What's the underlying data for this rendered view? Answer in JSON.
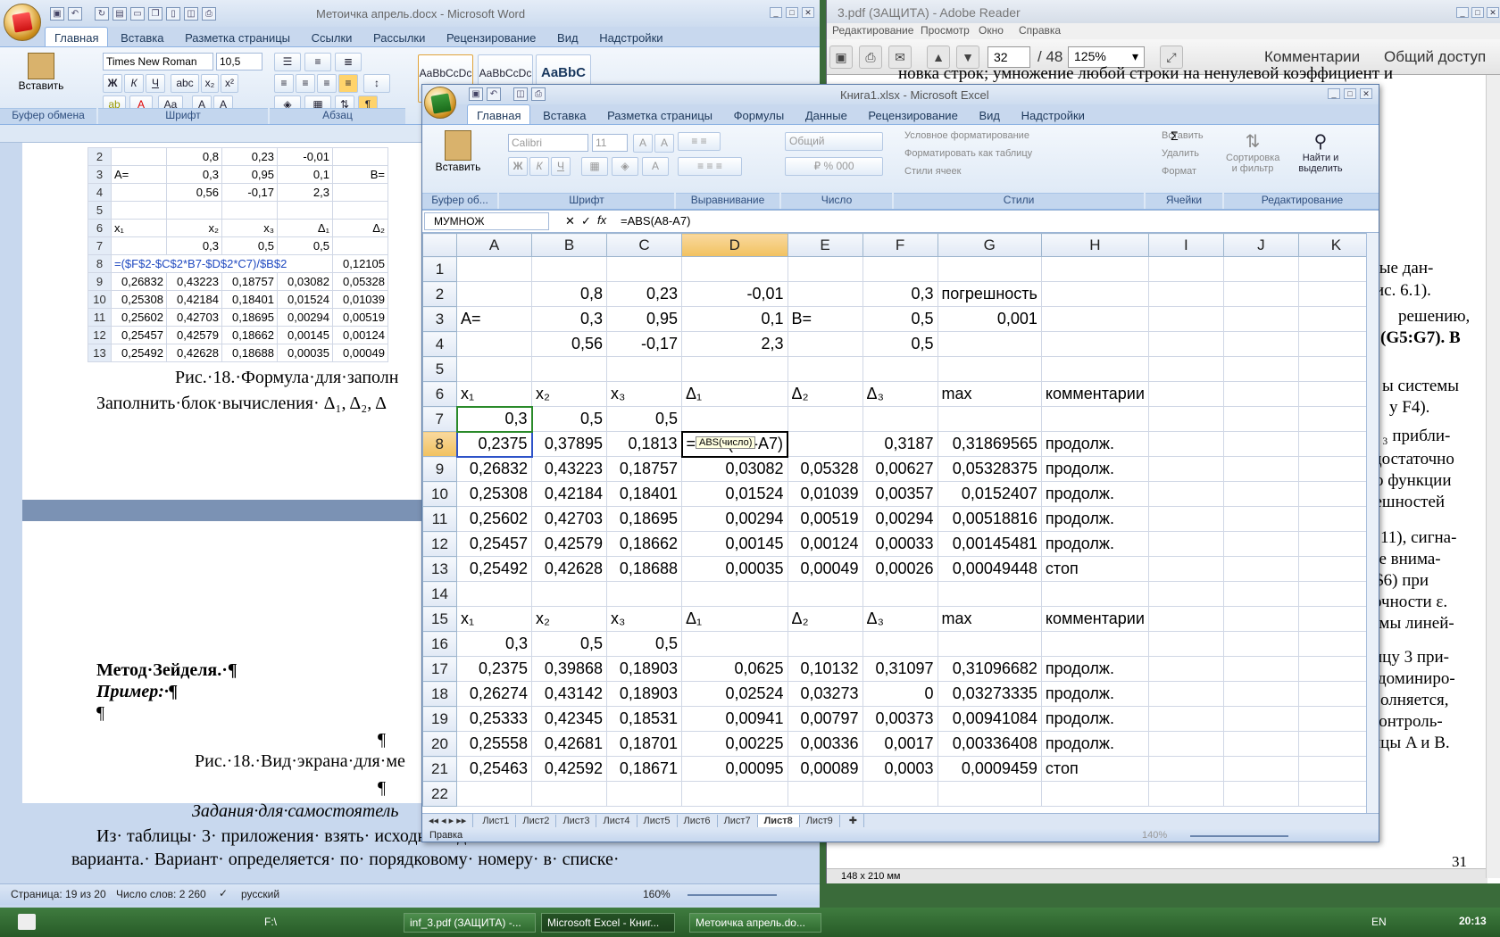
{
  "reader": {
    "title": "3.pdf (ЗАЩИТА) - Adobe Reader",
    "menu": [
      "Редактирование",
      "Просмотр",
      "Окно",
      "Справка"
    ],
    "page_current": "32",
    "page_total": "/ 48",
    "zoom": "125%",
    "comments": "Комментарии",
    "share": "Общий доступ",
    "page_lines": [
      "новка строк; умножение любой строки на ненулевой коэффициент и",
      "й",
      "одные дан-",
      ", рис. 6.1).",
      "решению,",
      "(G5:G7). В",
      "ы системы",
      "у F4).",
      "₃ прибли-",
      "достаточно",
      "о функции",
      "решностей",
      "11), сигна-",
      "ите внима-",
      "($I$6) при",
      "точности ε.",
      "емы линей-",
      "ицу 3 при-",
      "доминиро-",
      "олняется,",
      "контроль-",
      "ицы A и B."
    ],
    "page_number": "31",
    "page_size": "148 x 210 мм"
  },
  "word": {
    "title": "Метоичка апрель.docx - Microsoft Word",
    "tabs": [
      "Главная",
      "Вставка",
      "Разметка страницы",
      "Ссылки",
      "Рассылки",
      "Рецензирование",
      "Вид",
      "Надстройки"
    ],
    "font_name": "Times New Roman",
    "font_size": "10,5",
    "paste": "Вставить",
    "groups": [
      "Буфер обмена",
      "Шрифт",
      "Абзац"
    ],
    "style1": "AaBbCcDc",
    "style2": "AaBbCcDc",
    "style3": "AaBbC",
    "sheet_rows": [
      [
        "2",
        "",
        "0,8",
        "0,23",
        "-0,01",
        ""
      ],
      [
        "3",
        "A=",
        "0,3",
        "0,95",
        "0,1",
        "B="
      ],
      [
        "4",
        "",
        "0,56",
        "-0,17",
        "2,3",
        ""
      ],
      [
        "5",
        "",
        "",
        "",
        "",
        ""
      ],
      [
        "6",
        "x₁",
        "x₂",
        "x₃",
        "Δ₁",
        "Δ₂"
      ],
      [
        "7",
        "",
        "0,3",
        "0,5",
        "0,5",
        ""
      ],
      [
        "8",
        "=($F$2-$C$2*B7-$D$2*C7)/$B$2",
        "",
        "",
        "",
        "0,12105"
      ],
      [
        "9",
        "0,26832",
        "0,43223",
        "0,18757",
        "0,03082",
        "0,05328"
      ],
      [
        "10",
        "0,25308",
        "0,42184",
        "0,18401",
        "0,01524",
        "0,01039"
      ],
      [
        "11",
        "0,25602",
        "0,42703",
        "0,18695",
        "0,00294",
        "0,00519"
      ],
      [
        "12",
        "0,25457",
        "0,42579",
        "0,18662",
        "0,00145",
        "0,00124"
      ],
      [
        "13",
        "0,25492",
        "0,42628",
        "0,18688",
        "0,00035",
        "0,00049"
      ]
    ],
    "caption1": "Рис.·18.·Формула·для·заполн",
    "line2": "Заполнить·блок·вычисления· Δ₁, Δ₂, Δ",
    "seidel": "Метод·Зейделя.·¶",
    "example": "Пример:·¶",
    "pilcrow": "¶",
    "caption2": "Рис.·18.·Вид·экрана·для·ме",
    "tasks": "Задания·для·самостоятель",
    "line_a": "Из· таблицы· 3· приложения· взять· исходные· данные· своего",
    "line_b": "варианта.· Вариант· определяется· по· порядковому· номеру· в· списке·",
    "status_page": "Страница: 19 из 20",
    "status_words": "Число слов: 2 260",
    "status_lang": "русский",
    "zoom": "160%"
  },
  "excel": {
    "title": "Книга1.xlsx - Microsoft Excel",
    "tabs": [
      "Главная",
      "Вставка",
      "Разметка страницы",
      "Формулы",
      "Данные",
      "Рецензирование",
      "Вид",
      "Надстройки"
    ],
    "paste": "Вставить",
    "font_name": "Calibri",
    "font_size": "11",
    "number_format": "Общий",
    "styles": [
      "Условное форматирование",
      "Форматировать как таблицу",
      "Стили ячеек"
    ],
    "cells_btns": [
      "Вставить",
      "Удалить",
      "Формат"
    ],
    "edit_btns": [
      "Сортировка и фильтр",
      "Найти и выделить"
    ],
    "groups": [
      "Буфер об...",
      "Шрифт",
      "Выравнивание",
      "Число",
      "Стили",
      "Ячейки",
      "Редактирование"
    ],
    "name_box": "МУМНОЖ",
    "formula": "=ABS(A8-A7)",
    "tooltip": "ABS(число)",
    "columns": [
      "A",
      "B",
      "C",
      "D",
      "E",
      "F",
      "G",
      "H",
      "I",
      "J",
      "K"
    ],
    "rows": [
      [
        "1",
        "",
        "",
        "",
        "",
        "",
        "",
        "",
        "",
        "",
        "",
        ""
      ],
      [
        "2",
        "",
        "0,8",
        "0,23",
        "-0,01",
        "",
        "0,3",
        "погрешность",
        "",
        "",
        "",
        ""
      ],
      [
        "3",
        "A=",
        "0,3",
        "0,95",
        "0,1",
        "B=",
        "0,5",
        "0,001",
        "",
        "",
        "",
        ""
      ],
      [
        "4",
        "",
        "0,56",
        "-0,17",
        "2,3",
        "",
        "0,5",
        "",
        "",
        "",
        "",
        ""
      ],
      [
        "5",
        "",
        "",
        "",
        "",
        "",
        "",
        "",
        "",
        "",
        "",
        ""
      ],
      [
        "6",
        "x₁",
        "x₂",
        "x₃",
        "Δ₁",
        "Δ₂",
        "Δ₃",
        "max",
        "комментарии",
        "",
        "",
        ""
      ],
      [
        "7",
        "0,3",
        "0,5",
        "0,5",
        "",
        "",
        "",
        "",
        "",
        "",
        "",
        ""
      ],
      [
        "8",
        "0,2375",
        "0,37895",
        "0,1813",
        "=ABS(A8-A7)",
        "",
        "0,3187",
        "0,31869565",
        "продолж.",
        "",
        "",
        ""
      ],
      [
        "9",
        "0,26832",
        "0,43223",
        "0,18757",
        "0,03082",
        "0,05328",
        "0,00627",
        "0,05328375",
        "продолж.",
        "",
        "",
        ""
      ],
      [
        "10",
        "0,25308",
        "0,42184",
        "0,18401",
        "0,01524",
        "0,01039",
        "0,00357",
        "0,0152407",
        "продолж.",
        "",
        "",
        ""
      ],
      [
        "11",
        "0,25602",
        "0,42703",
        "0,18695",
        "0,00294",
        "0,00519",
        "0,00294",
        "0,00518816",
        "продолж.",
        "",
        "",
        ""
      ],
      [
        "12",
        "0,25457",
        "0,42579",
        "0,18662",
        "0,00145",
        "0,00124",
        "0,00033",
        "0,00145481",
        "продолж.",
        "",
        "",
        ""
      ],
      [
        "13",
        "0,25492",
        "0,42628",
        "0,18688",
        "0,00035",
        "0,00049",
        "0,00026",
        "0,00049448",
        "стоп",
        "",
        "",
        ""
      ],
      [
        "14",
        "",
        "",
        "",
        "",
        "",
        "",
        "",
        "",
        "",
        "",
        ""
      ],
      [
        "15",
        "x₁",
        "x₂",
        "x₃",
        "Δ₁",
        "Δ₂",
        "Δ₃",
        "max",
        "комментарии",
        "",
        "",
        ""
      ],
      [
        "16",
        "0,3",
        "0,5",
        "0,5",
        "",
        "",
        "",
        "",
        "",
        "",
        "",
        ""
      ],
      [
        "17",
        "0,2375",
        "0,39868",
        "0,18903",
        "0,0625",
        "0,10132",
        "0,31097",
        "0,31096682",
        "продолж.",
        "",
        "",
        ""
      ],
      [
        "18",
        "0,26274",
        "0,43142",
        "0,18903",
        "0,02524",
        "0,03273",
        "0",
        "0,03273335",
        "продолж.",
        "",
        "",
        ""
      ],
      [
        "19",
        "0,25333",
        "0,42345",
        "0,18531",
        "0,00941",
        "0,00797",
        "0,00373",
        "0,00941084",
        "продолж.",
        "",
        "",
        ""
      ],
      [
        "20",
        "0,25558",
        "0,42681",
        "0,18701",
        "0,00225",
        "0,00336",
        "0,0017",
        "0,00336408",
        "продолж.",
        "",
        "",
        ""
      ],
      [
        "21",
        "0,25463",
        "0,42592",
        "0,18671",
        "0,00095",
        "0,00089",
        "0,0003",
        "0,0009459",
        "стоп",
        "",
        "",
        ""
      ],
      [
        "22",
        "",
        "",
        "",
        "",
        "",
        "",
        "",
        "",
        "",
        "",
        ""
      ]
    ],
    "sheets": [
      "Лист1",
      "Лист2",
      "Лист3",
      "Лист4",
      "Лист5",
      "Лист6",
      "Лист7",
      "Лист8",
      "Лист9"
    ],
    "status": "Правка",
    "zoom": "140%"
  },
  "taskbar": {
    "drive": "F:\\",
    "tasks": [
      "inf_3.pdf (ЗАЩИТА) -...",
      "Microsoft Excel - Книг...",
      "Метоичка апрель.do..."
    ],
    "lang": "EN",
    "clock": "20:13"
  }
}
